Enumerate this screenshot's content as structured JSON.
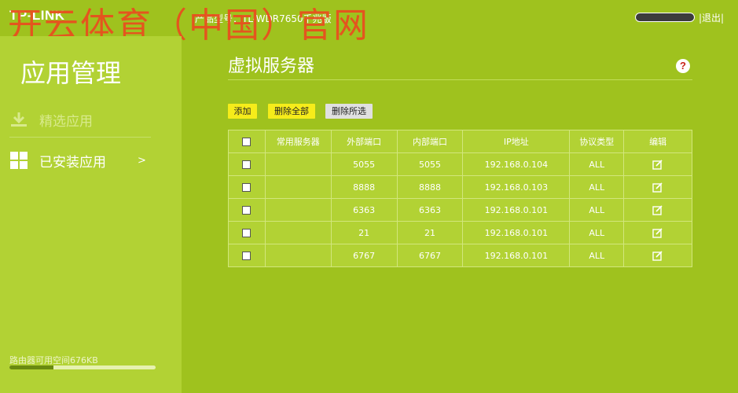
{
  "header": {
    "logo": "TP-LINK",
    "model": "产品型号：TL-WDR7650千兆版",
    "logout": "|退出|",
    "watermark": "开云体育（中国）官网"
  },
  "sidebar": {
    "title": "应用管理",
    "items": [
      {
        "label": "精选应用",
        "icon": "download-icon"
      },
      {
        "label": "已安装应用",
        "icon": "grid-icon",
        "arrow": ">"
      }
    ],
    "storage_label": "路由器可用空间676KB",
    "storage_fraction": 0.3
  },
  "main": {
    "title": "虚拟服务器",
    "help": "?",
    "buttons": {
      "add": "添加",
      "delete_all": "删除全部",
      "delete_selected": "删除所选"
    },
    "table": {
      "headers": [
        "常用服务器",
        "外部端口",
        "内部端口",
        "IP地址",
        "协议类型",
        "编辑"
      ],
      "rows": [
        {
          "server": "",
          "ext": "5055",
          "int": "5055",
          "ip": "192.168.0.104",
          "proto": "ALL"
        },
        {
          "server": "",
          "ext": "8888",
          "int": "8888",
          "ip": "192.168.0.103",
          "proto": "ALL"
        },
        {
          "server": "",
          "ext": "6363",
          "int": "6363",
          "ip": "192.168.0.101",
          "proto": "ALL"
        },
        {
          "server": "",
          "ext": "21",
          "int": "21",
          "ip": "192.168.0.101",
          "proto": "ALL"
        },
        {
          "server": "",
          "ext": "6767",
          "int": "6767",
          "ip": "192.168.0.101",
          "proto": "ALL"
        }
      ]
    }
  },
  "colors": {
    "background": "#9fc21e",
    "sidebar": "#b2d234",
    "button_yellow": "#f6ec1a",
    "watermark": "#e8501f"
  }
}
